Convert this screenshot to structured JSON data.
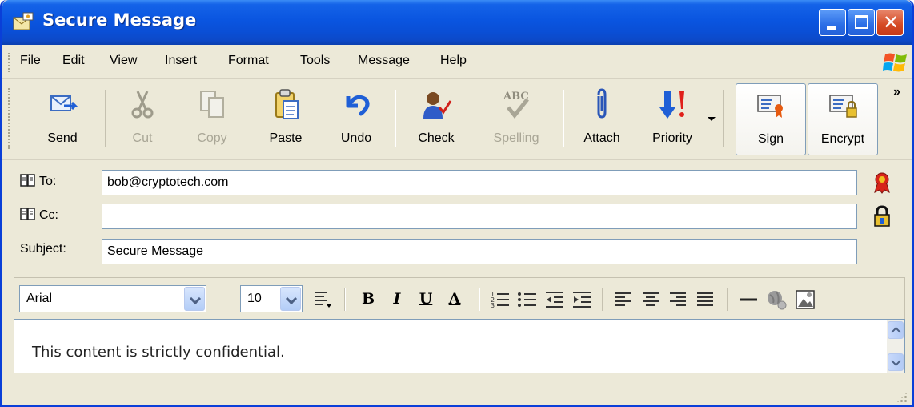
{
  "window": {
    "title": "Secure Message"
  },
  "menu": {
    "items": [
      "File",
      "Edit",
      "View",
      "Insert",
      "Format",
      "Tools",
      "Message",
      "Help"
    ]
  },
  "toolbar": {
    "buttons": [
      {
        "label": "Send",
        "icon": "send-icon",
        "enabled": true
      },
      {
        "label": "Cut",
        "icon": "cut-icon",
        "enabled": false
      },
      {
        "label": "Copy",
        "icon": "copy-icon",
        "enabled": false
      },
      {
        "label": "Paste",
        "icon": "paste-icon",
        "enabled": true
      },
      {
        "label": "Undo",
        "icon": "undo-icon",
        "enabled": true
      },
      {
        "label": "Check",
        "icon": "check-names-icon",
        "enabled": true
      },
      {
        "label": "Spelling",
        "icon": "spelling-icon",
        "enabled": false
      },
      {
        "label": "Attach",
        "icon": "paperclip-icon",
        "enabled": true
      },
      {
        "label": "Priority",
        "icon": "priority-icon",
        "enabled": true
      },
      {
        "label": "Sign",
        "icon": "sign-certificate-icon",
        "enabled": true,
        "pressed": true
      },
      {
        "label": "Encrypt",
        "icon": "encrypt-lock-icon",
        "enabled": true,
        "pressed": true
      }
    ],
    "overflow": "»"
  },
  "address": {
    "to_label": "To:",
    "to_value": "bob@cryptotech.com",
    "cc_label": "Cc:",
    "cc_value": "",
    "subject_label": "Subject:",
    "subject_value": "Secure Message"
  },
  "format": {
    "font": "Arial",
    "size": "10",
    "bold": "B",
    "italic": "I",
    "underline": "U",
    "font_color": "A"
  },
  "message": {
    "body": "This content is strictly confidential."
  },
  "colors": {
    "title_bar": "#0a55e0",
    "close_button": "#d54a24",
    "chrome": "#ece9d8",
    "field_border": "#7f9db9",
    "priority_red": "#e0201a",
    "priority_blue": "#1f5fd6"
  }
}
